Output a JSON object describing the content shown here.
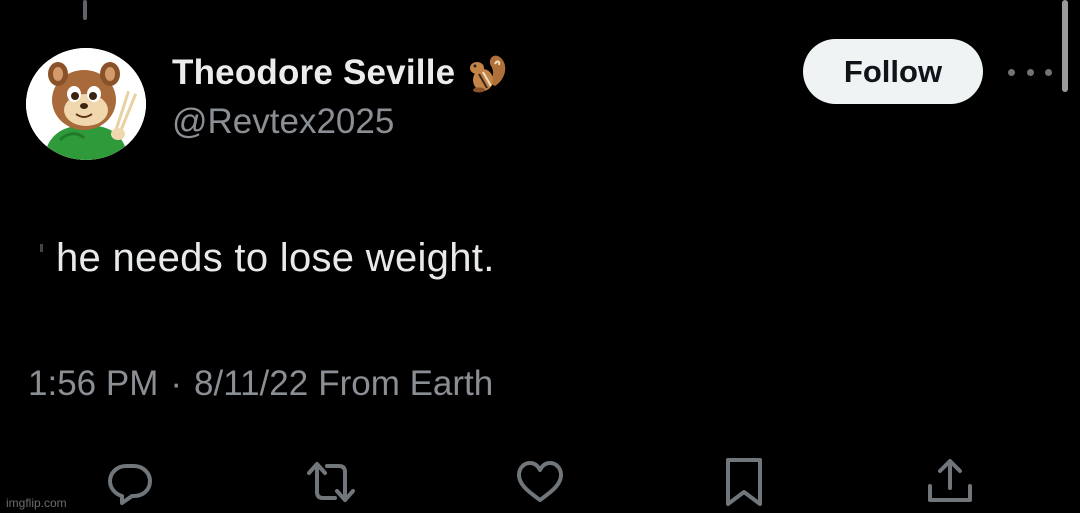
{
  "tweet": {
    "display_name": "Theodore Seville",
    "name_emoji": "🐿️",
    "handle": "@Revtex2025",
    "follow_label": "Follow",
    "text": "he needs to lose weight.",
    "time": "1:56 PM",
    "separator": "·",
    "date": "8/11/22",
    "source": "From Earth"
  },
  "actions": [
    {
      "icon": "reply-icon"
    },
    {
      "icon": "retweet-icon"
    },
    {
      "icon": "like-icon"
    },
    {
      "icon": "bookmark-icon"
    },
    {
      "icon": "share-icon"
    }
  ],
  "watermark": "imgflip.com",
  "colors": {
    "background": "#000000",
    "primary_text": "#e7e9ea",
    "secondary_text": "#8b8f94",
    "follow_button_bg": "#eff3f4",
    "icon": "#71767b"
  }
}
